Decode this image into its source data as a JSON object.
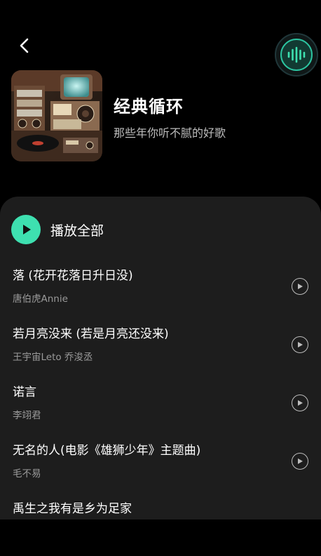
{
  "header": {
    "back_icon": "chevron-left-icon",
    "now_playing_icon": "sound-wave-icon",
    "accent_color": "#3ee0b0"
  },
  "playlist": {
    "title": "经典循环",
    "subtitle": "那些年你听不腻的好歌",
    "cover_icon": "retro-radio-cover-image"
  },
  "list": {
    "play_all_label": "播放全部",
    "songs": [
      {
        "title": "落 (花开花落日升日没)",
        "artist": "唐伯虎Annie"
      },
      {
        "title": "若月亮没来 (若是月亮还没来)",
        "artist": "王宇宙Leto 乔浚丞"
      },
      {
        "title": "诺言",
        "artist": "李翊君"
      },
      {
        "title": "无名的人(电影《雄狮少年》主题曲)",
        "artist": "毛不易"
      },
      {
        "title": "禹生之我有是乡为足家",
        "artist": ""
      }
    ]
  }
}
